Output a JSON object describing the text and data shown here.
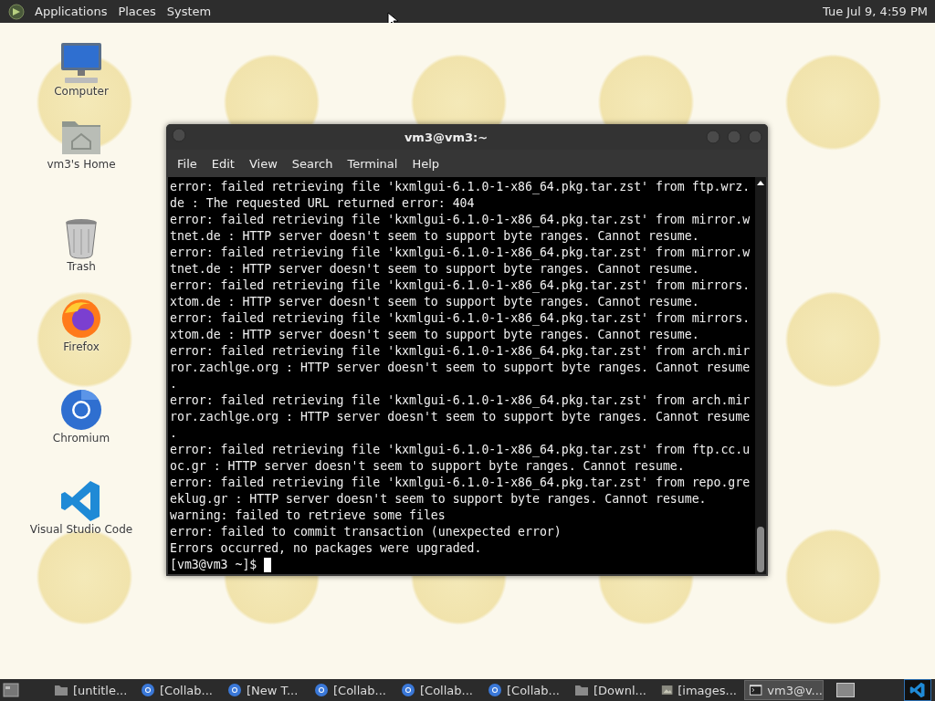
{
  "top_panel": {
    "menus": [
      "Applications",
      "Places",
      "System"
    ],
    "clock": "Tue Jul 9, 4:59 PM"
  },
  "desktop_icons": [
    {
      "label": "Computer",
      "kind": "computer"
    },
    {
      "label": "vm3's Home",
      "kind": "home"
    },
    {
      "label": "Trash",
      "kind": "trash"
    },
    {
      "label": "Firefox",
      "kind": "firefox"
    },
    {
      "label": "Chromium",
      "kind": "chromium"
    },
    {
      "label": "Visual Studio Code",
      "kind": "vscode"
    }
  ],
  "window": {
    "title": "vm3@vm3:~",
    "menu": [
      "File",
      "Edit",
      "View",
      "Search",
      "Terminal",
      "Help"
    ],
    "lines": [
      "error: failed retrieving file 'kxmlgui-6.1.0-1-x86_64.pkg.tar.zst' from ftp.wrz.",
      "de : The requested URL returned error: 404",
      "error: failed retrieving file 'kxmlgui-6.1.0-1-x86_64.pkg.tar.zst' from mirror.w",
      "tnet.de : HTTP server doesn't seem to support byte ranges. Cannot resume.",
      "error: failed retrieving file 'kxmlgui-6.1.0-1-x86_64.pkg.tar.zst' from mirror.w",
      "tnet.de : HTTP server doesn't seem to support byte ranges. Cannot resume.",
      "error: failed retrieving file 'kxmlgui-6.1.0-1-x86_64.pkg.tar.zst' from mirrors.",
      "xtom.de : HTTP server doesn't seem to support byte ranges. Cannot resume.",
      "error: failed retrieving file 'kxmlgui-6.1.0-1-x86_64.pkg.tar.zst' from mirrors.",
      "xtom.de : HTTP server doesn't seem to support byte ranges. Cannot resume.",
      "error: failed retrieving file 'kxmlgui-6.1.0-1-x86_64.pkg.tar.zst' from arch.mir",
      "ror.zachlge.org : HTTP server doesn't seem to support byte ranges. Cannot resume",
      ".",
      "error: failed retrieving file 'kxmlgui-6.1.0-1-x86_64.pkg.tar.zst' from arch.mir",
      "ror.zachlge.org : HTTP server doesn't seem to support byte ranges. Cannot resume",
      ".",
      "error: failed retrieving file 'kxmlgui-6.1.0-1-x86_64.pkg.tar.zst' from ftp.cc.u",
      "oc.gr : HTTP server doesn't seem to support byte ranges. Cannot resume.",
      "error: failed retrieving file 'kxmlgui-6.1.0-1-x86_64.pkg.tar.zst' from repo.gre",
      "eklug.gr : HTTP server doesn't seem to support byte ranges. Cannot resume.",
      "warning: failed to retrieve some files",
      "error: failed to commit transaction (unexpected error)",
      "Errors occurred, no packages were upgraded."
    ],
    "prompt": "[vm3@vm3 ~]$"
  },
  "taskbar": {
    "items": [
      {
        "label": "[untitle...",
        "kind": "folder",
        "selected": false
      },
      {
        "label": "[Collab...",
        "kind": "chromium",
        "selected": false
      },
      {
        "label": "[New T...",
        "kind": "chromium",
        "selected": false
      },
      {
        "label": "[Collab...",
        "kind": "chromium",
        "selected": false
      },
      {
        "label": "[Collab...",
        "kind": "chromium",
        "selected": false
      },
      {
        "label": "[Collab...",
        "kind": "chromium",
        "selected": false
      },
      {
        "label": "[Downl...",
        "kind": "folder",
        "selected": false
      },
      {
        "label": "[images...",
        "kind": "image",
        "selected": false
      },
      {
        "label": "vm3@v...",
        "kind": "terminal",
        "selected": true
      }
    ]
  }
}
